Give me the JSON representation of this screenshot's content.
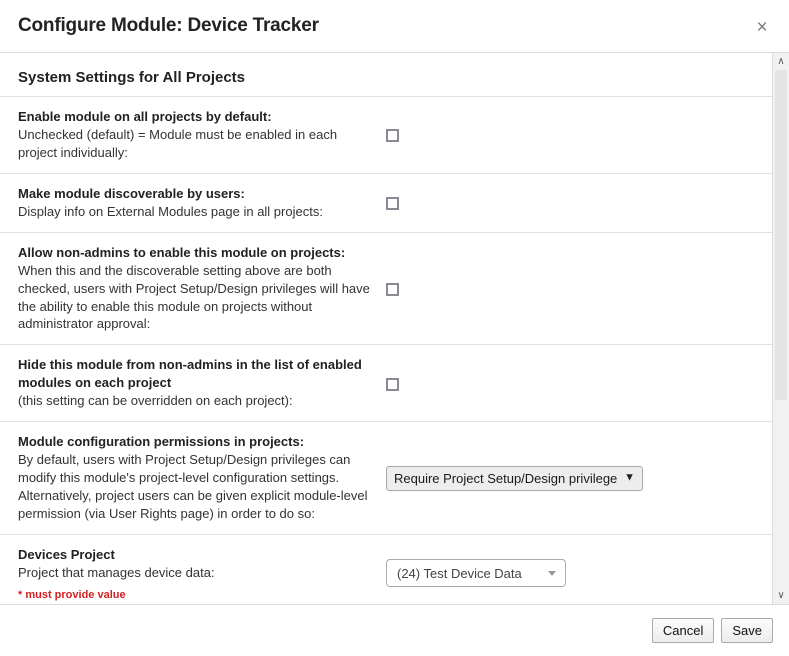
{
  "dialog": {
    "title": "Configure Module: Device Tracker",
    "close_label": "×"
  },
  "section": {
    "header": "System Settings for All Projects"
  },
  "settings": [
    {
      "title": "Enable module on all projects by default:",
      "description": "Unchecked (default) = Module must be enabled in each project individually:",
      "control": "checkbox",
      "checked": false
    },
    {
      "title": "Make module discoverable by users:",
      "description": "Display info on External Modules page in all projects:",
      "control": "checkbox",
      "checked": false
    },
    {
      "title": "Allow non-admins to enable this module on projects:",
      "description": "When this and the discoverable setting above are both checked, users with Project Setup/Design privileges will have the ability to enable this module on projects without administrator approval:",
      "control": "checkbox",
      "checked": false
    },
    {
      "title": "Hide this module from non-admins in the list of enabled modules on each project",
      "description": "(this setting can be overridden on each project):",
      "control": "checkbox",
      "checked": false
    },
    {
      "title": "Module configuration permissions in projects:",
      "description": "By default, users with Project Setup/Design privileges can modify this module's project-level configuration settings. Alternatively, project users can be given explicit module-level permission (via User Rights page) in order to do so:",
      "control": "native-select",
      "value": "Require Project Setup/Design privilege"
    },
    {
      "title": "Devices Project",
      "description": "Project that manages device data:",
      "required_note": "* must provide value",
      "control": "select2",
      "value": "(24) Test Device Data"
    }
  ],
  "scrollbar": {
    "up_arrow": "∧",
    "down_arrow": "∨"
  },
  "footer": {
    "cancel_label": "Cancel",
    "save_label": "Save"
  },
  "colors": {
    "required_text": "#d32121",
    "divider": "#e3e3e3",
    "header_border": "#dddddd"
  }
}
